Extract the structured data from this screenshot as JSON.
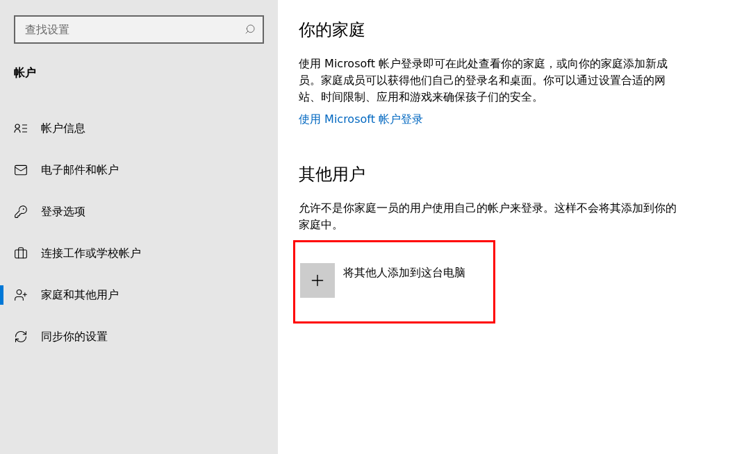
{
  "search": {
    "placeholder": "查找设置"
  },
  "sidebar": {
    "title": "帐户",
    "items": [
      {
        "label": "帐户信息",
        "kind": "info",
        "selected": false
      },
      {
        "label": "电子邮件和帐户",
        "kind": "mail",
        "selected": false
      },
      {
        "label": "登录选项",
        "kind": "key",
        "selected": false
      },
      {
        "label": "连接工作或学校帐户",
        "kind": "briefcase",
        "selected": false
      },
      {
        "label": "家庭和其他用户",
        "kind": "family",
        "selected": true
      },
      {
        "label": "同步你的设置",
        "kind": "sync",
        "selected": false
      }
    ]
  },
  "family": {
    "title": "你的家庭",
    "description": "使用 Microsoft 帐户登录即可在此处查看你的家庭，或向你的家庭添加新成员。家庭成员可以获得他们自己的登录名和桌面。你可以通过设置合适的网站、时间限制、应用和游戏来确保孩子们的安全。",
    "link": "使用 Microsoft 帐户登录"
  },
  "other_users": {
    "title": "其他用户",
    "description": "允许不是你家庭一员的用户使用自己的帐户来登录。这样不会将其添加到你的家庭中。",
    "add_button": {
      "label": "将其他人添加到这台电脑",
      "highlighted": true
    }
  }
}
